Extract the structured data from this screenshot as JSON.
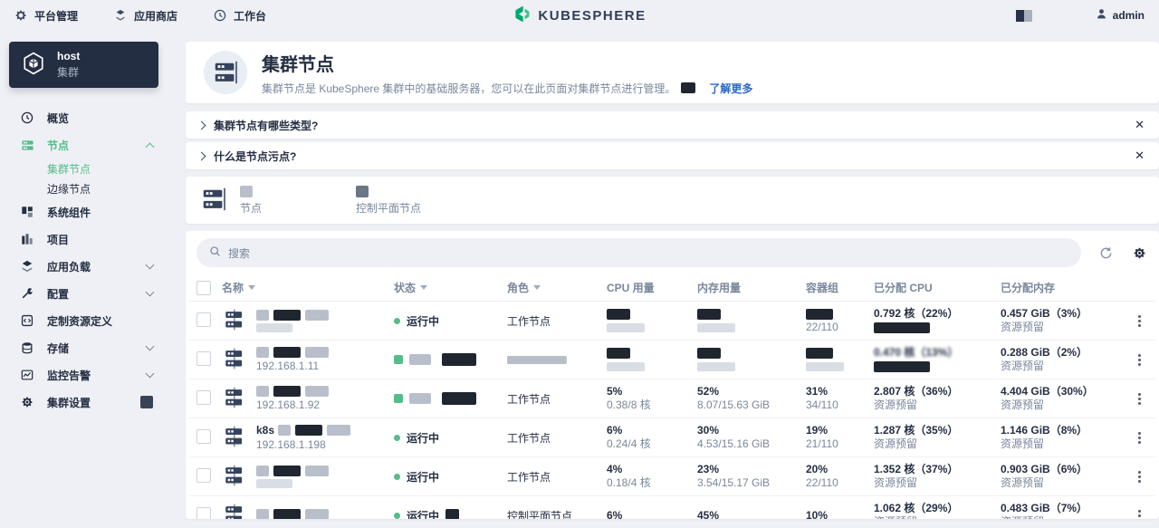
{
  "topbar": {
    "left_items": [
      {
        "label": "平台管理",
        "icon": "gear-icon"
      },
      {
        "label": "应用商店",
        "icon": "appstore-icon"
      },
      {
        "label": "工作台",
        "icon": "workbench-icon"
      }
    ],
    "logo_text": "KUBESPHERE",
    "user": "admin"
  },
  "sidebar": {
    "cluster": {
      "name": "host",
      "type": "集群"
    },
    "items": [
      {
        "label": "概览",
        "icon": "overview-icon"
      },
      {
        "label": "节点",
        "icon": "nodes-icon",
        "active": true,
        "expanded": true,
        "children": [
          {
            "label": "集群节点",
            "active": true
          },
          {
            "label": "边缘节点",
            "active": false
          }
        ]
      },
      {
        "label": "系统组件",
        "icon": "components-icon"
      },
      {
        "label": "项目",
        "icon": "projects-icon"
      },
      {
        "label": "应用负载",
        "icon": "workloads-icon",
        "collapsible": true
      },
      {
        "label": "配置",
        "icon": "config-icon",
        "collapsible": true
      },
      {
        "label": "定制资源定义",
        "icon": "crd-icon"
      },
      {
        "label": "存储",
        "icon": "storage-icon",
        "collapsible": true
      },
      {
        "label": "监控告警",
        "icon": "monitoring-icon",
        "collapsible": true
      },
      {
        "label": "集群设置",
        "icon": "settings-icon",
        "badge_redacted": true
      }
    ]
  },
  "banner": {
    "title": "集群节点",
    "description": "集群节点是 KubeSphere 集群中的基础服务器，您可以在此页面对集群节点进行管理。",
    "learn_more": "了解更多"
  },
  "faq": [
    {
      "question": "集群节点有哪些类型?"
    },
    {
      "question": "什么是节点污点?"
    }
  ],
  "stats": {
    "items": [
      {
        "label": "节点",
        "count_redacted": true
      },
      {
        "label": "控制平面节点",
        "count_redacted": true
      }
    ]
  },
  "toolbar": {
    "search_placeholder": "搜索"
  },
  "table": {
    "columns": [
      {
        "label": "名称",
        "sortable": true
      },
      {
        "label": "状态",
        "sortable": true
      },
      {
        "label": "角色",
        "sortable": true
      },
      {
        "label": "CPU 用量",
        "sortable": false
      },
      {
        "label": "内存用量",
        "sortable": false
      },
      {
        "label": "容器组",
        "sortable": false
      },
      {
        "label": "已分配 CPU",
        "sortable": false
      },
      {
        "label": "已分配内存",
        "sortable": false
      }
    ],
    "rows": [
      {
        "name": {
          "redacted": true,
          "ip": "",
          "ip_redacted": true
        },
        "status": {
          "text": "运行中"
        },
        "role": {
          "text": "工作节点"
        },
        "cpu": {
          "redacted": true
        },
        "mem": {
          "redacted": true
        },
        "pods": {
          "redacted": true,
          "detail": "22/110"
        },
        "alloc_cpu": {
          "text": "0.792 核（22%）",
          "sub": "",
          "sub_redacted": true
        },
        "alloc_mem": {
          "text": "0.457 GiB（3%）",
          "sub": "资源预留"
        }
      },
      {
        "name": {
          "redacted": true,
          "ip": "192.168.1.11"
        },
        "status": {
          "redacted": true
        },
        "role": {
          "redacted": true
        },
        "cpu": {
          "redacted": true
        },
        "mem": {
          "redacted": true
        },
        "pods": {
          "redacted": true
        },
        "alloc_cpu": {
          "text": "0.470 核（13%）",
          "blurred": true,
          "sub": "",
          "sub_redacted": true
        },
        "alloc_mem": {
          "text": "0.288 GiB（2%）",
          "sub": "资源预留"
        }
      },
      {
        "name": {
          "redacted": true,
          "ip": "192.168.1.92"
        },
        "status": {
          "redacted": true
        },
        "role": {
          "text": "工作节点"
        },
        "cpu": {
          "pct": "5%",
          "detail": "0.38/8 核"
        },
        "mem": {
          "pct": "52%",
          "detail": "8.07/15.63 GiB"
        },
        "pods": {
          "pct": "31%",
          "detail": "34/110"
        },
        "alloc_cpu": {
          "text": "2.807 核（36%）",
          "sub": "资源预留"
        },
        "alloc_mem": {
          "text": "4.404 GiB（30%）",
          "sub": "资源预留"
        }
      },
      {
        "name": {
          "prefix": "k8s",
          "redacted": true,
          "ip": "192.168.1.198"
        },
        "status": {
          "text": "运行中"
        },
        "role": {
          "text": "工作节点"
        },
        "cpu": {
          "pct": "6%",
          "detail": "0.24/4 核"
        },
        "mem": {
          "pct": "30%",
          "detail": "4.53/15.16 GiB"
        },
        "pods": {
          "pct": "19%",
          "detail": "21/110"
        },
        "alloc_cpu": {
          "text": "1.287 核（35%）",
          "sub": "资源预留"
        },
        "alloc_mem": {
          "text": "1.146 GiB（8%）",
          "sub": "资源预留"
        }
      },
      {
        "name": {
          "redacted": true,
          "ip": "",
          "ip_redacted": true
        },
        "status": {
          "text": "运行中"
        },
        "role": {
          "text": "工作节点"
        },
        "cpu": {
          "pct": "4%",
          "detail": "0.18/4 核"
        },
        "mem": {
          "pct": "23%",
          "detail": "3.54/15.17 GiB"
        },
        "pods": {
          "pct": "20%",
          "detail": "22/110"
        },
        "alloc_cpu": {
          "text": "1.352 核（37%）",
          "sub": "资源预留"
        },
        "alloc_mem": {
          "text": "0.903 GiB（6%）",
          "sub": "资源预留"
        }
      },
      {
        "name": {
          "redacted": true
        },
        "status": {
          "text": "运行中",
          "badge_redacted": true
        },
        "role": {
          "text": "控制平面节点"
        },
        "cpu": {
          "pct": "6%",
          "detail": ""
        },
        "mem": {
          "pct": "45%",
          "detail": ""
        },
        "pods": {
          "pct": "10%",
          "detail": ""
        },
        "alloc_cpu": {
          "text": "1.062 核（29%）",
          "sub": "资源预留"
        },
        "alloc_mem": {
          "text": "0.483 GiB（7%）",
          "sub": "资源预留"
        }
      }
    ]
  },
  "colors": {
    "accent_green": "#55bc8a",
    "dark": "#242e42",
    "secondary_text": "#79879c",
    "link_blue": "#2d68c8",
    "page_bg": "#eff0f5"
  }
}
